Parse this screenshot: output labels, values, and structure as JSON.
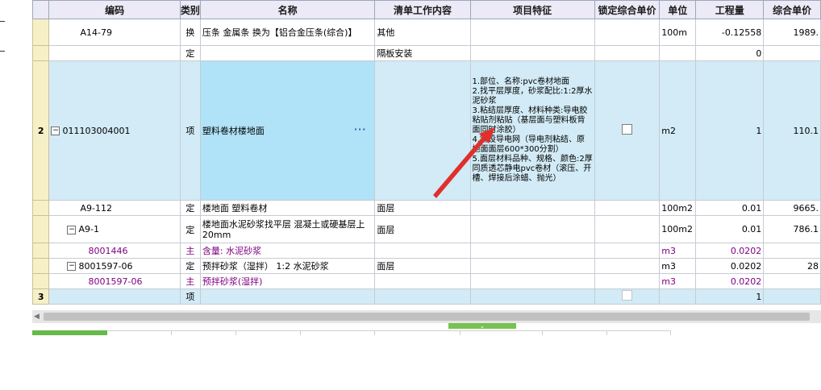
{
  "headers": {
    "code": "编码",
    "type": "类别",
    "name": "名称",
    "work": "清单工作内容",
    "feature": "项目特征",
    "lock_price": "锁定综合单价",
    "unit": "单位",
    "quantity": "工程量",
    "unit_price": "综合单价"
  },
  "rows": [
    {
      "num": "",
      "code": "A14-79",
      "type": "换",
      "name": "压条 金属条  换为【铝合金压条(综合)】",
      "work": "其他",
      "unit": "100m",
      "quantity": "-0.12558",
      "price": "1989."
    },
    {
      "num": "",
      "code": "",
      "type": "定",
      "name": "",
      "work": "隔板安装",
      "unit": "",
      "quantity": "0",
      "price": ""
    },
    {
      "num": "2",
      "code": "011103004001",
      "type": "项",
      "name": "塑料卷材楼地面",
      "feature": "1.部位、名称:pvc卷材地面\n2.找平层厚度，砂浆配比:1:2厚水泥砂浆\n3.粘结层厚度、材料种类:导电胶粘贴剂粘贴（基层面与塑料板背面同时涂胶）\n4.铺设导电网（导电剂粘结、原地面面层600*300分割）\n5.面层材料品种、规格、颜色:2厚同质透芯静电pvc卷材（滚压、开槽、焊接后涂蜡、抛光）",
      "unit": "m2",
      "quantity": "1",
      "price": "110.1"
    },
    {
      "num": "",
      "code": "A9-112",
      "type": "定",
      "name": "楼地面 塑料卷材",
      "work": "面层",
      "unit": "100m2",
      "quantity": "0.01",
      "price": "9665."
    },
    {
      "num": "",
      "code": "A9-1",
      "type": "定",
      "name": "楼地面水泥砂浆找平层 混凝土或硬基层上 20mm",
      "work": "面层",
      "unit": "100m2",
      "quantity": "0.01",
      "price": "786.1"
    },
    {
      "num": "",
      "code": "8001446",
      "type": "主",
      "name": "含量: 水泥砂浆",
      "work": "",
      "unit": "m3",
      "quantity": "0.0202",
      "price": ""
    },
    {
      "num": "",
      "code": "8001597-06",
      "type": "定",
      "name": "预拌砂浆（湿拌） 1:2 水泥砂浆",
      "work": "面层",
      "unit": "m3",
      "quantity": "0.0202",
      "price": "28"
    },
    {
      "num": "",
      "code": "8001597-06",
      "type": "主",
      "name": "预拌砂浆(湿拌)",
      "work": "",
      "unit": "m3",
      "quantity": "0.0202",
      "price": ""
    },
    {
      "num": "3",
      "code": "",
      "type": "项",
      "name": "",
      "work": "",
      "unit": "",
      "quantity": "1",
      "price": ""
    }
  ],
  "colors": {
    "selected_row": "#d2ebf6",
    "selected_cell": "#b0e3f7",
    "row_number": "#f7f0c6",
    "material_text": "#800080",
    "accent_green": "#67b949",
    "arrow": "#e0302c"
  },
  "icons": {
    "collapse": "minus-box-icon",
    "ellipsis": "ellipsis-icon",
    "scroll_left": "triangle-left-icon",
    "splitter": "double-chevron-down-icon"
  }
}
